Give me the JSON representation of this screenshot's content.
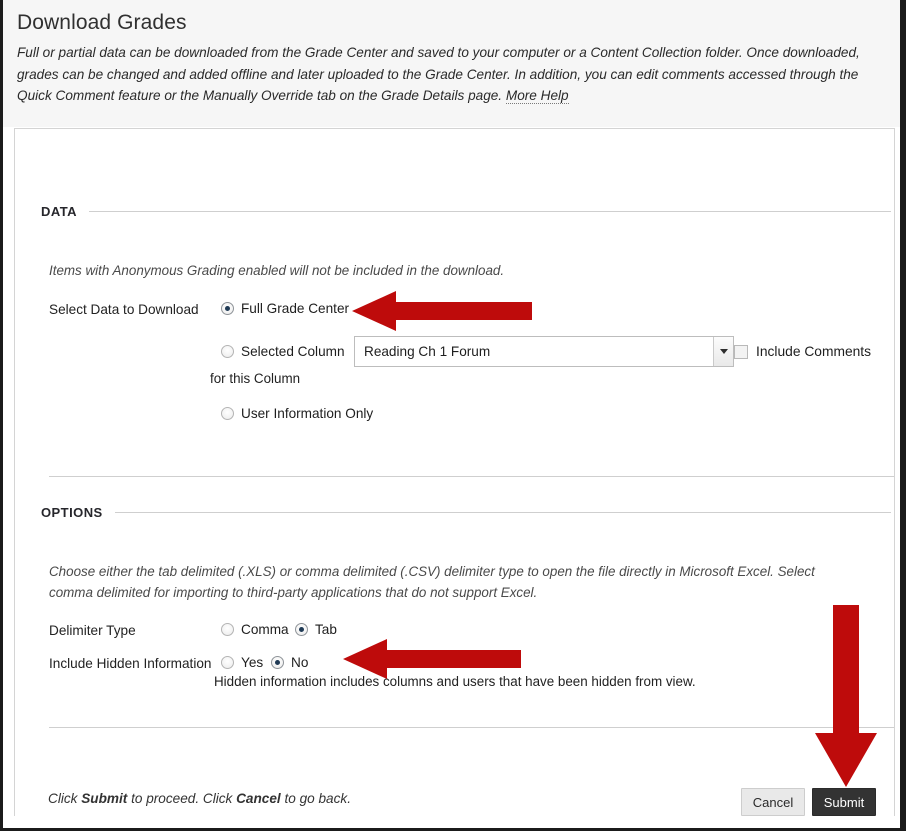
{
  "header": {
    "title": "Download Grades",
    "description": "Full or partial data can be downloaded from the Grade Center and saved to your computer or a Content Collection folder. Once downloaded, grades can be changed and added offline and later uploaded to the Grade Center. In addition, you can edit comments accessed through the Quick Comment feature or the Manually Override tab on the Grade Details page.",
    "more_help": "More Help"
  },
  "data_section": {
    "heading": "DATA",
    "note": "Items with Anonymous Grading enabled will not be included in the download.",
    "field_label": "Select Data to Download",
    "options": [
      {
        "label": "Full Grade Center",
        "selected": true
      },
      {
        "label": "Selected Column",
        "selected": false
      },
      {
        "label": "User Information Only",
        "selected": false
      }
    ],
    "for_this_column": "for this Column",
    "column_select": {
      "value": "Reading Ch 1 Forum",
      "caret": "chevron-down-icon"
    },
    "include_comments": {
      "label": "Include Comments",
      "checked": false
    }
  },
  "options_section": {
    "heading": "OPTIONS",
    "note": "Choose either the tab delimited (.XLS) or comma delimited (.CSV) delimiter type to open the file directly in Microsoft Excel. Select comma delimited for importing to third-party applications that do not support Excel.",
    "delimiter": {
      "label": "Delimiter Type",
      "options": [
        {
          "label": "Comma",
          "selected": false
        },
        {
          "label": "Tab",
          "selected": true
        }
      ]
    },
    "hidden_info": {
      "label": "Include Hidden Information",
      "options": [
        {
          "label": "Yes",
          "selected": false
        },
        {
          "label": "No",
          "selected": true
        }
      ],
      "hint": "Hidden information includes columns and users that have been hidden from view."
    }
  },
  "footer": {
    "note_prefix": "Click ",
    "note_bold_1": "Submit",
    "note_middle": " to proceed. Click ",
    "note_bold_2": "Cancel",
    "note_suffix": " to go back.",
    "cancel_label": "Cancel",
    "submit_label": "Submit"
  },
  "annotations": {
    "color": "#BE0B0B",
    "arrows": [
      {
        "name": "arrow-pointing-to-full-grade-center",
        "direction": "left"
      },
      {
        "name": "arrow-pointing-to-delimiter-options",
        "direction": "left"
      },
      {
        "name": "arrow-pointing-to-submit-button",
        "direction": "down"
      }
    ]
  }
}
